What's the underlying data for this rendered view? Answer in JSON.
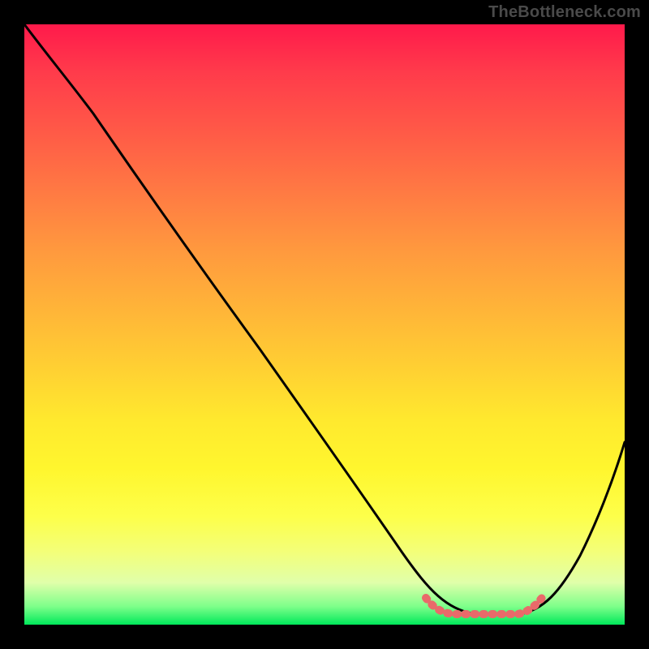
{
  "watermark": "TheBottleneck.com",
  "chart_data": {
    "type": "line",
    "title": "",
    "xlabel": "",
    "ylabel": "",
    "xlim": [
      0,
      100
    ],
    "ylim": [
      0,
      100
    ],
    "grid": false,
    "series": [
      {
        "name": "bottleneck-curve",
        "x": [
          0,
          6,
          12,
          18,
          24,
          30,
          36,
          42,
          48,
          54,
          60,
          64,
          68,
          72,
          76,
          80,
          84,
          88,
          92,
          96,
          100
        ],
        "values": [
          100,
          94,
          87,
          80,
          72,
          64,
          56,
          48,
          40,
          32,
          24,
          17,
          11,
          6,
          2,
          1,
          1,
          4,
          11,
          20,
          31
        ]
      }
    ],
    "highlight_region": {
      "note": "coral dotted band near trough",
      "x_start": 68,
      "x_end": 86,
      "y": 2
    },
    "gradient_stops": [
      {
        "pct": 0,
        "color": "#ff1a4b"
      },
      {
        "pct": 18,
        "color": "#ff5a47"
      },
      {
        "pct": 38,
        "color": "#ff9a3e"
      },
      {
        "pct": 58,
        "color": "#ffd232"
      },
      {
        "pct": 82,
        "color": "#fdff4a"
      },
      {
        "pct": 97,
        "color": "#7dff8a"
      },
      {
        "pct": 100,
        "color": "#00e85a"
      }
    ]
  }
}
